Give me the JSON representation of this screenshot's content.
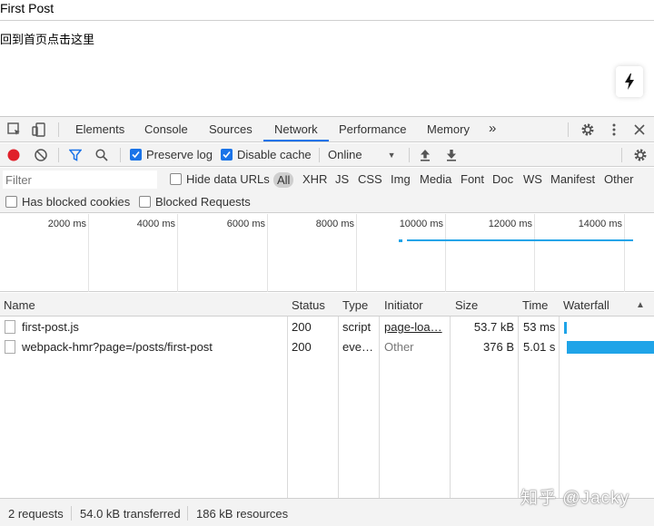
{
  "page": {
    "title": "First Post",
    "back_link": "回到首页点击这里"
  },
  "devtools": {
    "tabs": [
      {
        "label": "Elements"
      },
      {
        "label": "Console"
      },
      {
        "label": "Sources"
      },
      {
        "label": "Network"
      },
      {
        "label": "Performance"
      },
      {
        "label": "Memory"
      }
    ],
    "more_tabs_label": "»",
    "active_tab": "Network"
  },
  "toolbar": {
    "preserve_log": {
      "label": "Preserve log",
      "checked": true
    },
    "disable_cache": {
      "label": "Disable cache",
      "checked": true
    },
    "throttling": {
      "value": "Online",
      "arrow": "▼"
    }
  },
  "filter": {
    "placeholder": "Filter",
    "hide_data_urls": {
      "label": "Hide data URLs",
      "checked": false
    },
    "types": [
      "All",
      "XHR",
      "JS",
      "CSS",
      "Img",
      "Media",
      "Font",
      "Doc",
      "WS",
      "Manifest",
      "Other"
    ],
    "has_blocked_cookies": {
      "label": "Has blocked cookies",
      "checked": false
    },
    "blocked_requests": {
      "label": "Blocked Requests",
      "checked": false
    }
  },
  "overview": {
    "ticks": [
      "2000 ms",
      "4000 ms",
      "6000 ms",
      "8000 ms",
      "10000 ms",
      "12000 ms",
      "14000 ms"
    ]
  },
  "table": {
    "columns": [
      "Name",
      "Status",
      "Type",
      "Initiator",
      "Size",
      "Time",
      "Waterfall"
    ],
    "sort_indicator": "▲",
    "rows": [
      {
        "name": "first-post.js",
        "status": "200",
        "type": "script",
        "initiator": "page-loa…",
        "size": "53.7 kB",
        "time": "53 ms"
      },
      {
        "name": "webpack-hmr?page=/posts/first-post",
        "status": "200",
        "type": "eve…",
        "initiator": "Other",
        "size": "376 B",
        "time": "5.01 s"
      }
    ]
  },
  "status": {
    "requests": "2 requests",
    "transferred": "54.0 kB transferred",
    "resources": "186 kB resources"
  },
  "watermark": "知乎 @Jacky",
  "colors": {
    "accent": "#1a73e8",
    "record": "#e0202a",
    "waterfall": "#1fa4e8"
  },
  "icons": [
    "lightning-icon",
    "inspect-icon",
    "device-icon",
    "gear-icon",
    "kebab-icon",
    "close-icon",
    "record-icon",
    "clear-icon",
    "filter-icon",
    "search-icon",
    "upload-icon",
    "download-icon",
    "file-icon"
  ]
}
